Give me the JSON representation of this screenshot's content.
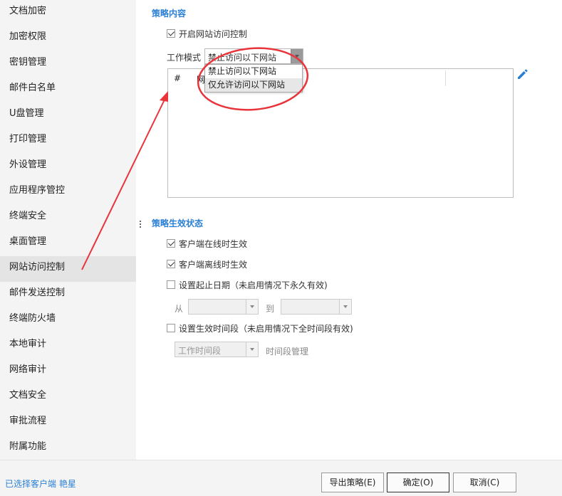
{
  "sidebar": {
    "items": [
      {
        "label": "文档加密"
      },
      {
        "label": "加密权限"
      },
      {
        "label": "密钥管理"
      },
      {
        "label": "邮件白名单"
      },
      {
        "label": "U盘管理"
      },
      {
        "label": "打印管理"
      },
      {
        "label": "外设管理"
      },
      {
        "label": "应用程序管控"
      },
      {
        "label": "终端安全"
      },
      {
        "label": "桌面管理"
      },
      {
        "label": "网站访问控制"
      },
      {
        "label": "邮件发送控制"
      },
      {
        "label": "终端防火墙"
      },
      {
        "label": "本地审计"
      },
      {
        "label": "网络审计"
      },
      {
        "label": "文档安全"
      },
      {
        "label": "审批流程"
      },
      {
        "label": "附属功能"
      }
    ],
    "active_index": 10
  },
  "policy": {
    "title": "策略内容",
    "enable_label": "开启网站访问控制",
    "enable_checked": true,
    "mode_label": "工作模式",
    "mode_value": "禁止访问以下网站",
    "mode_options": [
      "禁止访问以下网站",
      "仅允许访问以下网站"
    ],
    "table_headers": [
      "#",
      "网"
    ]
  },
  "effect": {
    "title": "策略生效状态",
    "online_label": "客户端在线时生效",
    "online_checked": true,
    "offline_label": "客户端离线时生效",
    "offline_checked": true,
    "date_label": "设置起止日期（未启用情况下永久有效)",
    "date_checked": false,
    "from_label": "从",
    "to_label": "到",
    "period_label": "设置生效时间段（未启用情况下全时间段有效)",
    "period_checked": false,
    "period_select": "工作时间段",
    "period_manage_label": "时间段管理"
  },
  "footer": {
    "status": "已选择客户端 艳星",
    "export_label": "导出策略(E)",
    "ok_label": "确定(O)",
    "cancel_label": "取消(C)"
  },
  "colors": {
    "accent": "#2a7fd4",
    "annotation": "#e8343a"
  }
}
